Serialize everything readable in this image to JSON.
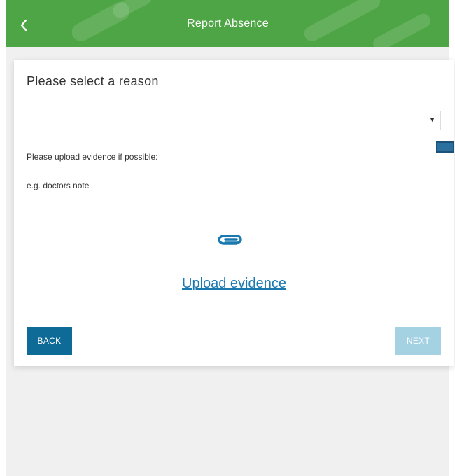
{
  "header": {
    "title": "Report Absence",
    "back_icon": "chevron-left-icon",
    "background_color": "#4ea545"
  },
  "card": {
    "heading": "Please select a reason",
    "reason_select": {
      "selected_value": "",
      "caret_icon": "▼"
    },
    "upload_prompt": "Please upload evidence if possible:",
    "upload_example": "e.g. doctors note",
    "attachment_icon": "paperclip-icon",
    "upload_link_label": "Upload evidence",
    "back_button_label": "BACK",
    "next_button_label": "NEXT",
    "accent_color": "#1a7ab0",
    "back_button_color": "#0e6a96",
    "next_button_disabled_color": "#a5d2e3"
  }
}
